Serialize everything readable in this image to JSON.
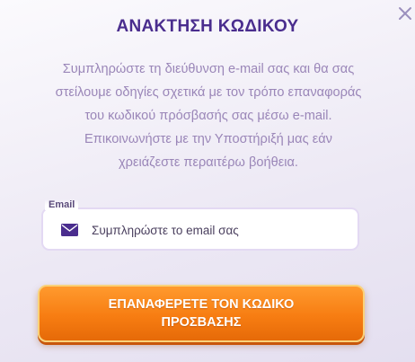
{
  "modal": {
    "title": "ΑΝΑΚΤΗΣΗ ΚΩΔΙΚΟΥ",
    "close_icon": "close-icon",
    "description": "Συμπληρώστε τη διεύθυνση e-mail σας και θα σας στείλουμε οδηγίες σχετικά με τον τρόπο επαναφοράς του κωδικού πρόσβασής σας μέσω e-mail. Επικοινωνήστε με την Υποστήριξή μας εάν χρειάζεστε περαιτέρω βοήθεια."
  },
  "email_field": {
    "label": "Email",
    "placeholder": "Συμπληρώστε το email σας",
    "value": "",
    "icon": "envelope-icon"
  },
  "submit": {
    "label": "ΕΠΑΝΑΦΕΡΕΤΕ ΤΟΝ ΚΩΔΙΚΟ ΠΡΟΣΒΑΣΗΣ"
  },
  "colors": {
    "title": "#4a2d8e",
    "text": "#9a86b8",
    "button": "#f77d12",
    "field_border": "#e3d9f3"
  }
}
